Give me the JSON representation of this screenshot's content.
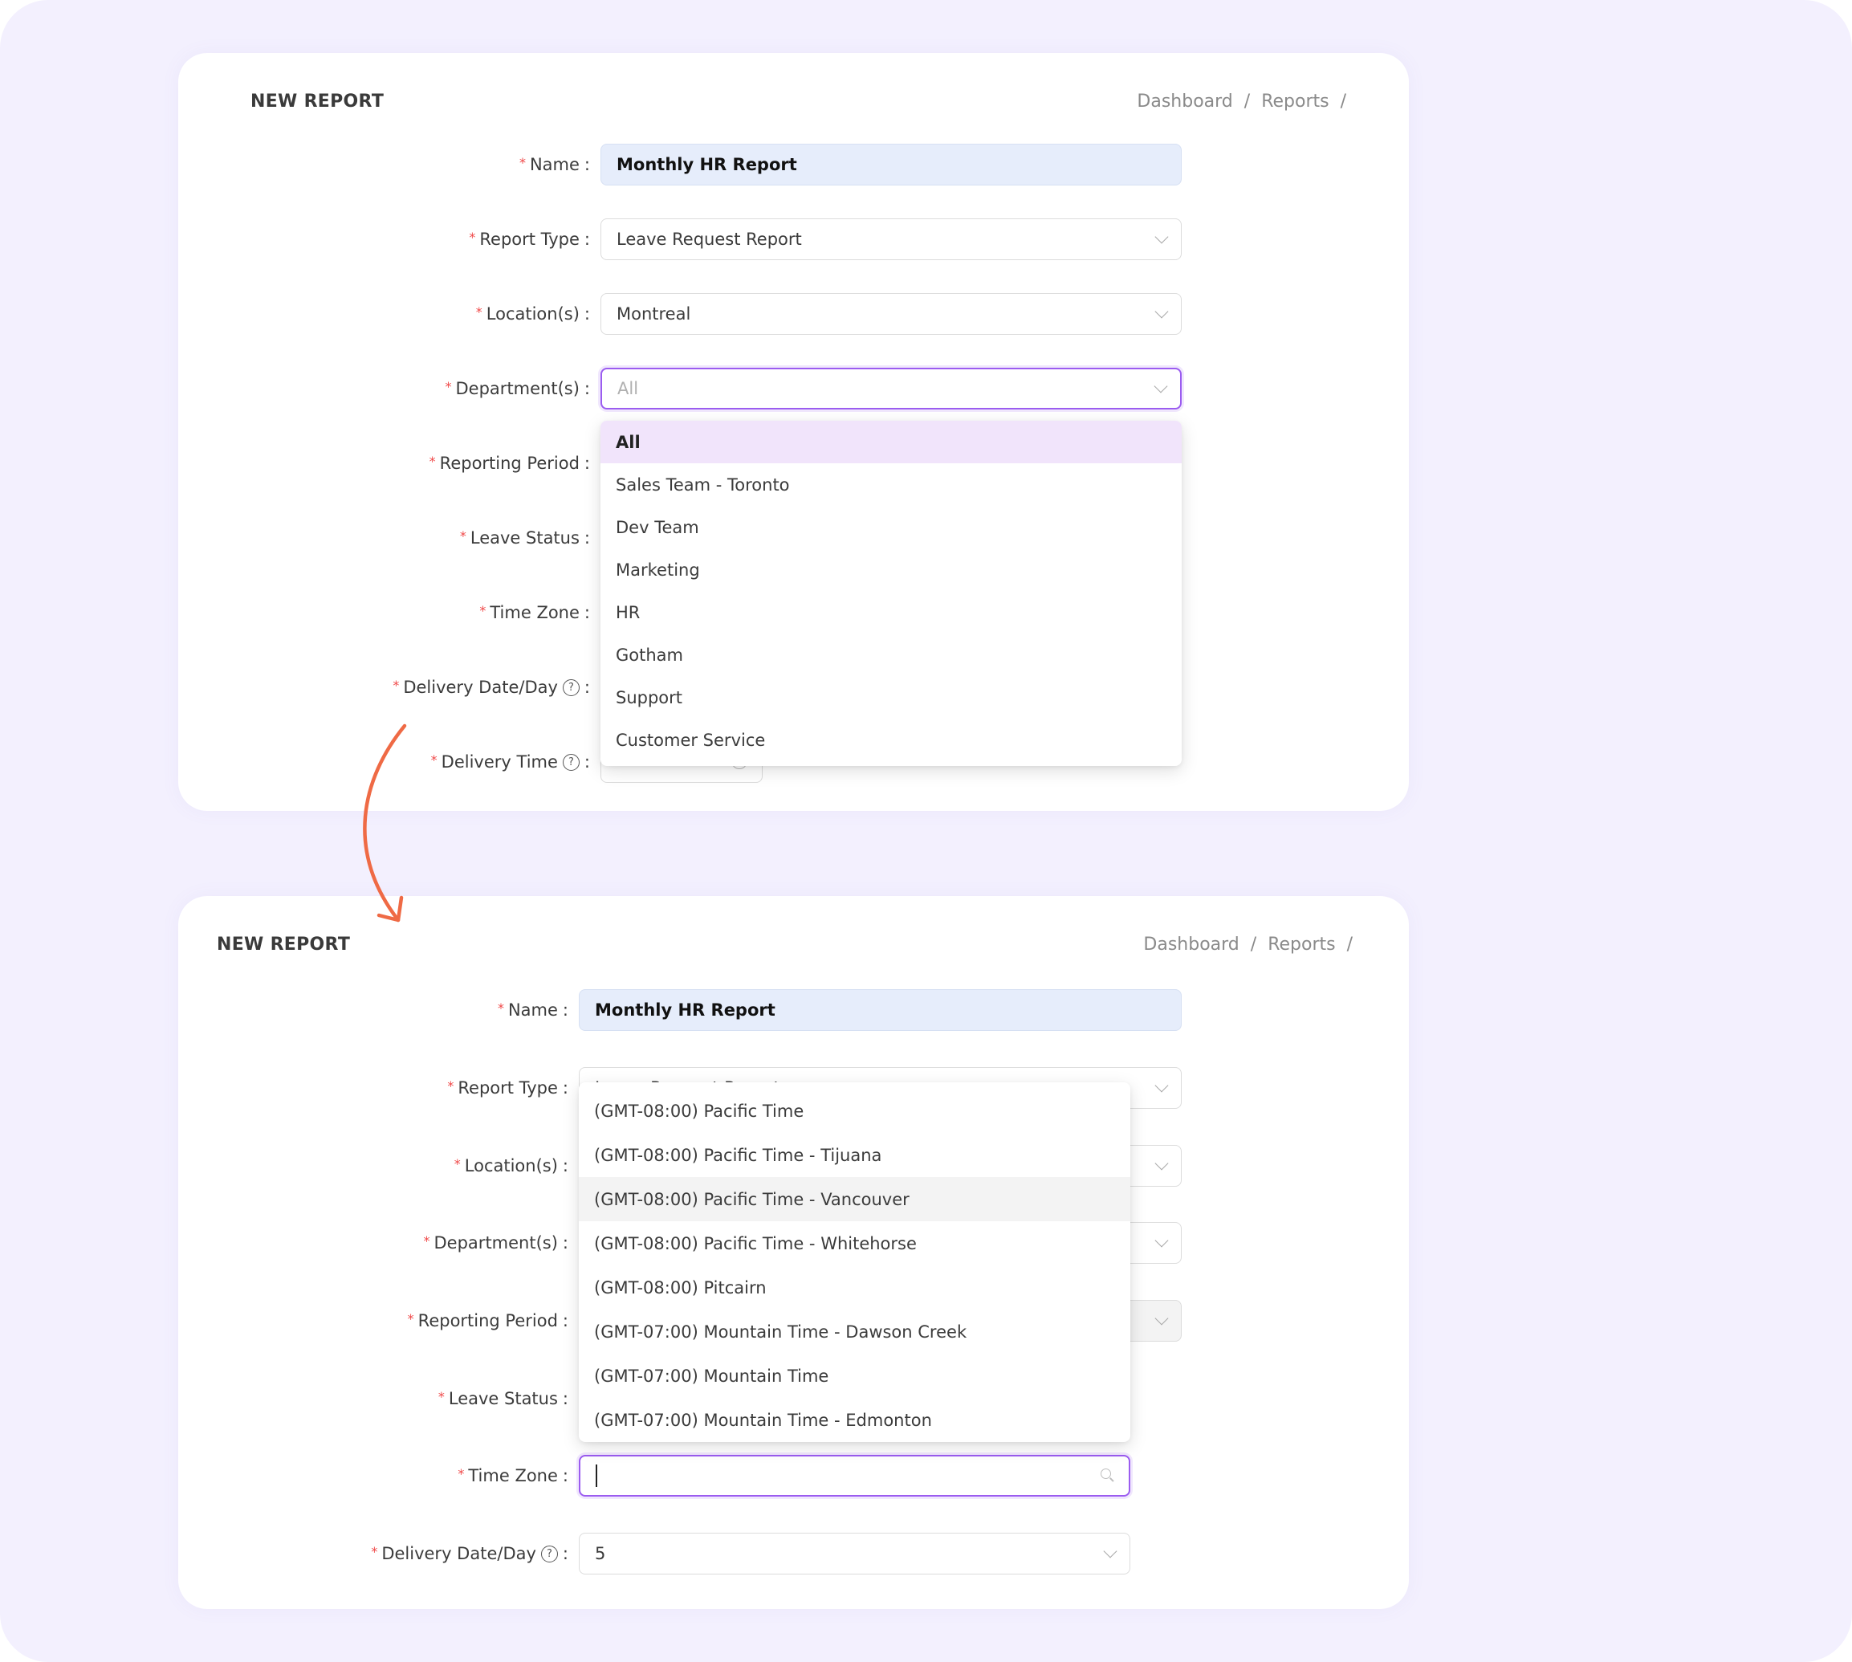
{
  "panel_before": {
    "title": "NEW REPORT",
    "breadcrumb": [
      "Dashboard",
      "Reports"
    ],
    "breadcrumb_separator": "/",
    "fields": {
      "name": {
        "label": "Name",
        "value": "Monthly HR Report"
      },
      "report_type": {
        "label": "Report Type",
        "value": "Leave Request Report"
      },
      "locations": {
        "label": "Location(s)",
        "value": "Montreal"
      },
      "departments": {
        "label": "Department(s)",
        "placeholder": "All"
      },
      "reporting_period": {
        "label": "Reporting Period"
      },
      "leave_status": {
        "label": "Leave Status"
      },
      "time_zone": {
        "label": "Time Zone"
      },
      "delivery_date": {
        "label": "Delivery Date/Day"
      },
      "delivery_time": {
        "label": "Delivery Time"
      }
    },
    "department_dropdown": {
      "options": [
        "All",
        "Sales Team - Toronto",
        "Dev Team",
        "Marketing",
        "HR",
        "Gotham",
        "Support",
        "Customer Service"
      ],
      "selected": "All"
    }
  },
  "panel_after": {
    "title": "NEW REPORT",
    "breadcrumb": [
      "Dashboard",
      "Reports"
    ],
    "breadcrumb_separator": "/",
    "fields": {
      "name": {
        "label": "Name",
        "value": "Monthly HR Report"
      },
      "report_type": {
        "label": "Report Type",
        "value": "Leave Request Report"
      },
      "locations": {
        "label": "Location(s)"
      },
      "departments": {
        "label": "Department(s)"
      },
      "reporting_period": {
        "label": "Reporting Period"
      },
      "leave_status": {
        "label": "Leave Status"
      },
      "time_zone": {
        "label": "Time Zone",
        "value": ""
      },
      "delivery_date": {
        "label": "Delivery Date/Day",
        "value": "5"
      }
    },
    "timezone_dropdown": {
      "options": [
        "(GMT-08:00) Pacific Time",
        "(GMT-08:00) Pacific Time - Tijuana",
        "(GMT-08:00) Pacific Time - Vancouver",
        "(GMT-08:00) Pacific Time - Whitehorse",
        "(GMT-08:00) Pitcairn",
        "(GMT-07:00) Mountain Time - Dawson Creek",
        "(GMT-07:00) Mountain Time",
        "(GMT-07:00) Mountain Time - Edmonton"
      ],
      "hovered": "(GMT-08:00) Pacific Time - Vancouver"
    }
  },
  "glyphs": {
    "required": "*",
    "colon": ":",
    "help": "?"
  },
  "colors": {
    "page_bg": "#f3f0fe",
    "focus_border": "#9b5cf0",
    "selected_option_bg": "#f1e4fb",
    "filled_input_bg": "#e6edfb",
    "required_star": "#f04848",
    "arrow": "#ef6a45"
  }
}
